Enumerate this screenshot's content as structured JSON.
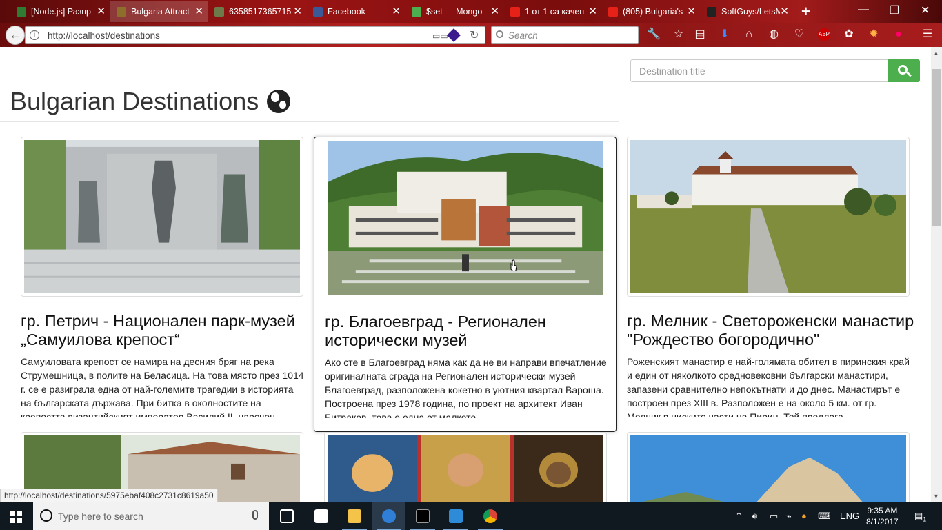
{
  "browser": {
    "tabs": [
      {
        "title": "[Node.js] Разпр",
        "color": "#2e7d32"
      },
      {
        "title": "Bulgaria Attract",
        "color": "#8d6e2b"
      },
      {
        "title": "6358517365715",
        "color": "#6d7a4a"
      },
      {
        "title": "Facebook",
        "color": "#3b5998"
      },
      {
        "title": "$set — Mongo",
        "color": "#4caf50"
      },
      {
        "title": "1 от 1 са качен",
        "color": "#e62117"
      },
      {
        "title": "(805) Bulgaria's",
        "color": "#e62117"
      },
      {
        "title": "SoftGuys/LetsM",
        "color": "#222222"
      }
    ],
    "url": "http://localhost/destinations",
    "search_placeholder": "Search",
    "status_url": "http://localhost/destinations/5975ebaf408c2731c8619a50"
  },
  "page": {
    "search_placeholder": "Destination title",
    "title": "Bulgarian Destinations",
    "accent": "#4cae4c",
    "cards": [
      {
        "title": "гр. Петрич - Национален парк-музей „Самуилова крепост“",
        "text": "Самуиловата крепост се намира на десния бряг на река Струмешница, в полите на Беласица. На това място през 1014 г. се е разиграла една от най-големите трагедии в историята на българската държава. При битка в околностите на крепостта византийският император Василий II, наречен",
        "image": "monument"
      },
      {
        "title": "гр. Благоевград - Регионален исторически музей",
        "text": "Ако сте в Благоевград няма как да не ви направи впечатление оригиналната сграда на Регионален исторически музей – Благоевград, разположена кокетно в уютния квартал Вароша. Построена през 1978 година, по проект на архитект Иван Битраков, това е една от малкото",
        "image": "museum"
      },
      {
        "title": "гр. Мелник - Светороженски манастир \"Рождество богородично\"",
        "text": "Роженският манастир е най-голямата обител в пиринския край и един от няколкото средновековни български манастири, запазени сравнително непокътнати и до днес. Манастирът е построен през XIII в. Разположен е на около 5 км. от гр. Мелник в ниските части на Пирин. Той предлага",
        "image": "monastery"
      }
    ]
  },
  "taskbar": {
    "search_placeholder": "Type here to search",
    "language": "ENG",
    "time": "9:35 AM",
    "date": "8/1/2017",
    "notifications": "1"
  }
}
